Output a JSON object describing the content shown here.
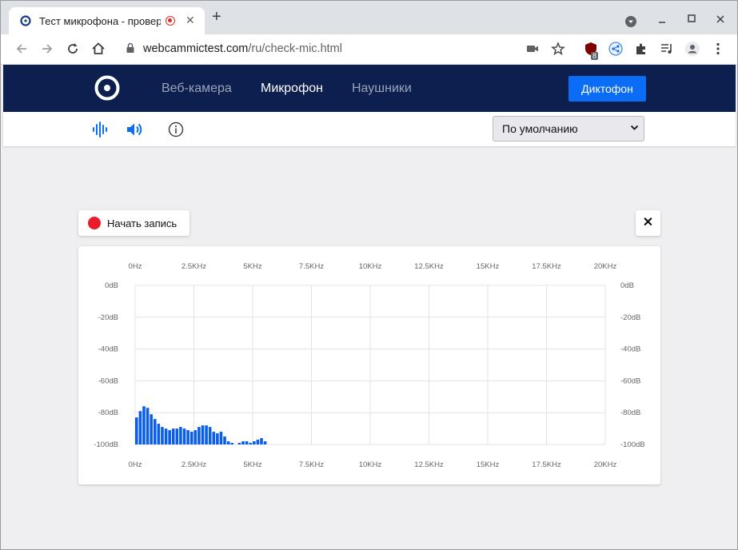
{
  "browser": {
    "tab_title": "Тест микрофона - провер",
    "tab_close": "✕",
    "new_tab": "+",
    "url_host": "webcammictest.com",
    "url_path": "/ru/check-mic.html",
    "extension_badge": "8"
  },
  "site": {
    "nav": [
      {
        "label": "Веб-камера",
        "active": false
      },
      {
        "label": "Микрофон",
        "active": true
      },
      {
        "label": "Наушники",
        "active": false
      }
    ],
    "dictaphone_button": "Диктофон",
    "device_select": "По умолчанию"
  },
  "recorder": {
    "start_label": "Начать запись",
    "close_label": "✕"
  },
  "colors": {
    "nav_bg": "#0d1f4f",
    "accent": "#0b6cf5",
    "record": "#ea1c2a",
    "bars": "#0b5ee8"
  },
  "chart_data": {
    "type": "bar",
    "title": "",
    "x_ticks": [
      "0Hz",
      "2.5KHz",
      "5KHz",
      "7.5KHz",
      "10KHz",
      "12.5KHz",
      "15KHz",
      "17.5KHz",
      "20KHz"
    ],
    "y_ticks": [
      "0dB",
      "-20dB",
      "-40dB",
      "-60dB",
      "-80dB",
      "-100dB"
    ],
    "xlim": [
      0,
      20000
    ],
    "ylim": [
      -100,
      0
    ],
    "grid": true,
    "bin_width_hz": 156.25,
    "values_db": [
      -83,
      -79,
      -76,
      -77,
      -81,
      -84,
      -87,
      -89,
      -90,
      -91,
      -90,
      -90,
      -89,
      -90,
      -91,
      -92,
      -91,
      -89,
      -88,
      -88,
      -89,
      -92,
      -93,
      -92,
      -95,
      -98,
      -99,
      -100,
      -99,
      -98,
      -98,
      -99,
      -98,
      -97,
      -96,
      -98
    ]
  }
}
